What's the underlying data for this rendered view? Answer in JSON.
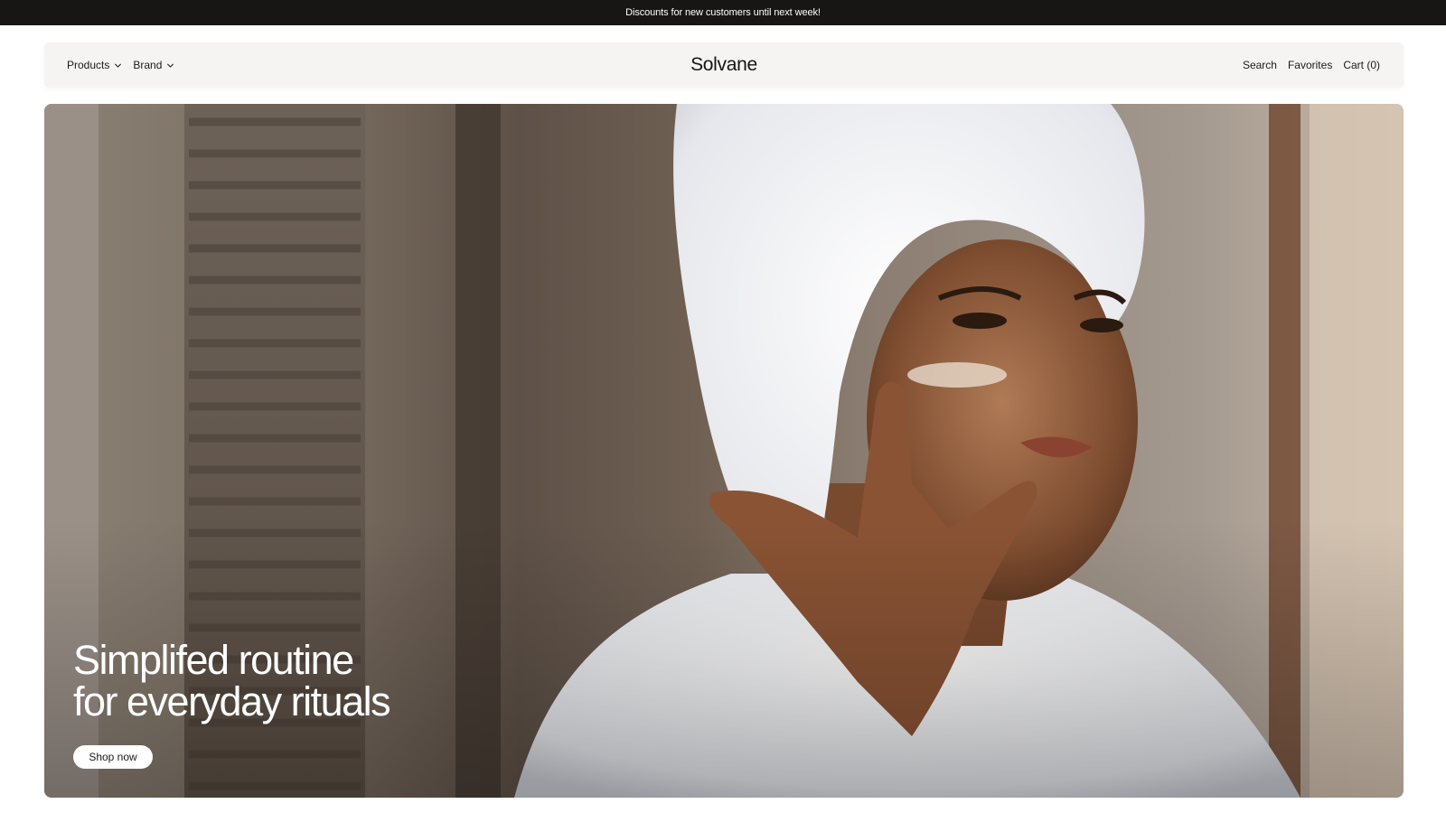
{
  "announcement": {
    "text": "Discounts for new customers until next week!"
  },
  "nav": {
    "products_label": "Products",
    "brand_menu_label": "Brand",
    "logo": "Solvane",
    "search_label": "Search",
    "favorites_label": "Favorites",
    "cart_label": "Cart (0)"
  },
  "hero": {
    "headline_line1": "Simplifed routine",
    "headline_line2": "for everyday rituals",
    "cta_label": "Shop now",
    "image_description_icon": "hero-photo"
  },
  "colors": {
    "announcement_bg": "#171614",
    "nav_bg": "#f5f4f2",
    "button_bg": "#ffffff",
    "headline_text": "#ffffff"
  }
}
